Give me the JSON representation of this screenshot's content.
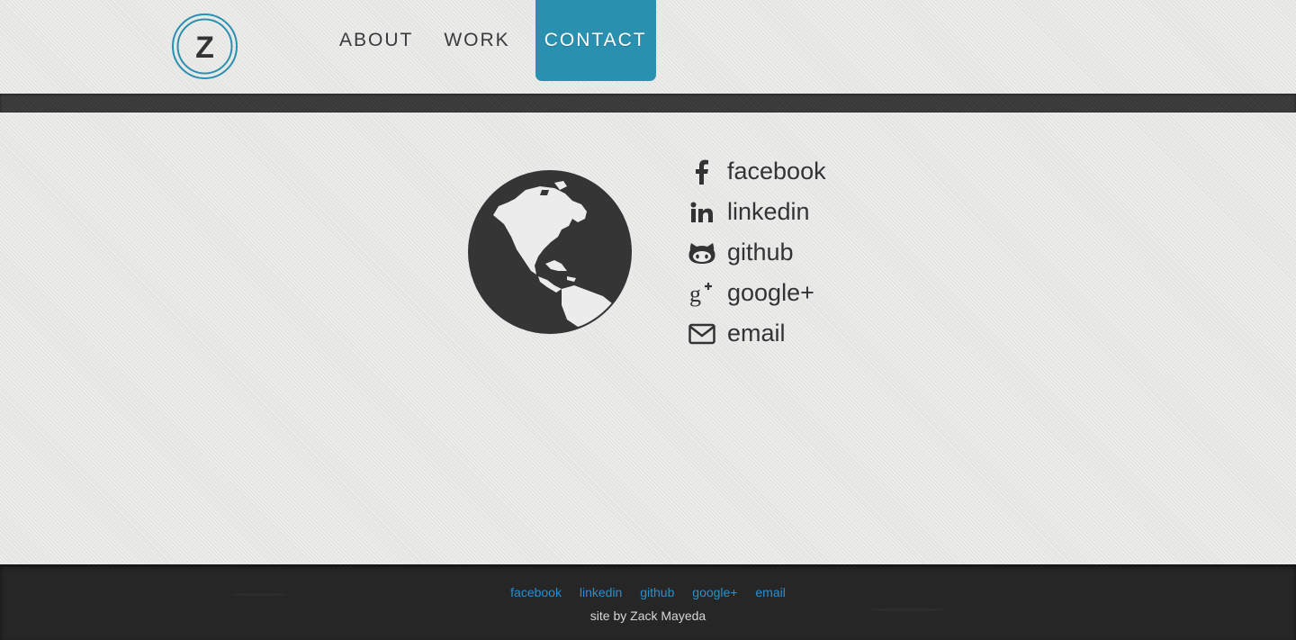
{
  "logo": {
    "letter": "Z"
  },
  "nav": {
    "items": [
      {
        "label": "ABOUT",
        "active": false
      },
      {
        "label": "WORK",
        "active": false
      },
      {
        "label": "CONTACT",
        "active": true
      }
    ]
  },
  "contact": {
    "items": [
      {
        "label": "facebook",
        "icon": "facebook-icon"
      },
      {
        "label": "linkedin",
        "icon": "linkedin-icon"
      },
      {
        "label": "github",
        "icon": "github-icon"
      },
      {
        "label": "google+",
        "icon": "google-plus-icon"
      },
      {
        "label": "email",
        "icon": "email-icon"
      }
    ]
  },
  "footer": {
    "links": [
      "facebook",
      "linkedin",
      "github",
      "google+",
      "email"
    ],
    "credit": "site by Zack Mayeda"
  },
  "colors": {
    "accent": "#2a90b0",
    "link": "#2a8fd0",
    "text": "#333333",
    "footer_bg": "#262626"
  }
}
